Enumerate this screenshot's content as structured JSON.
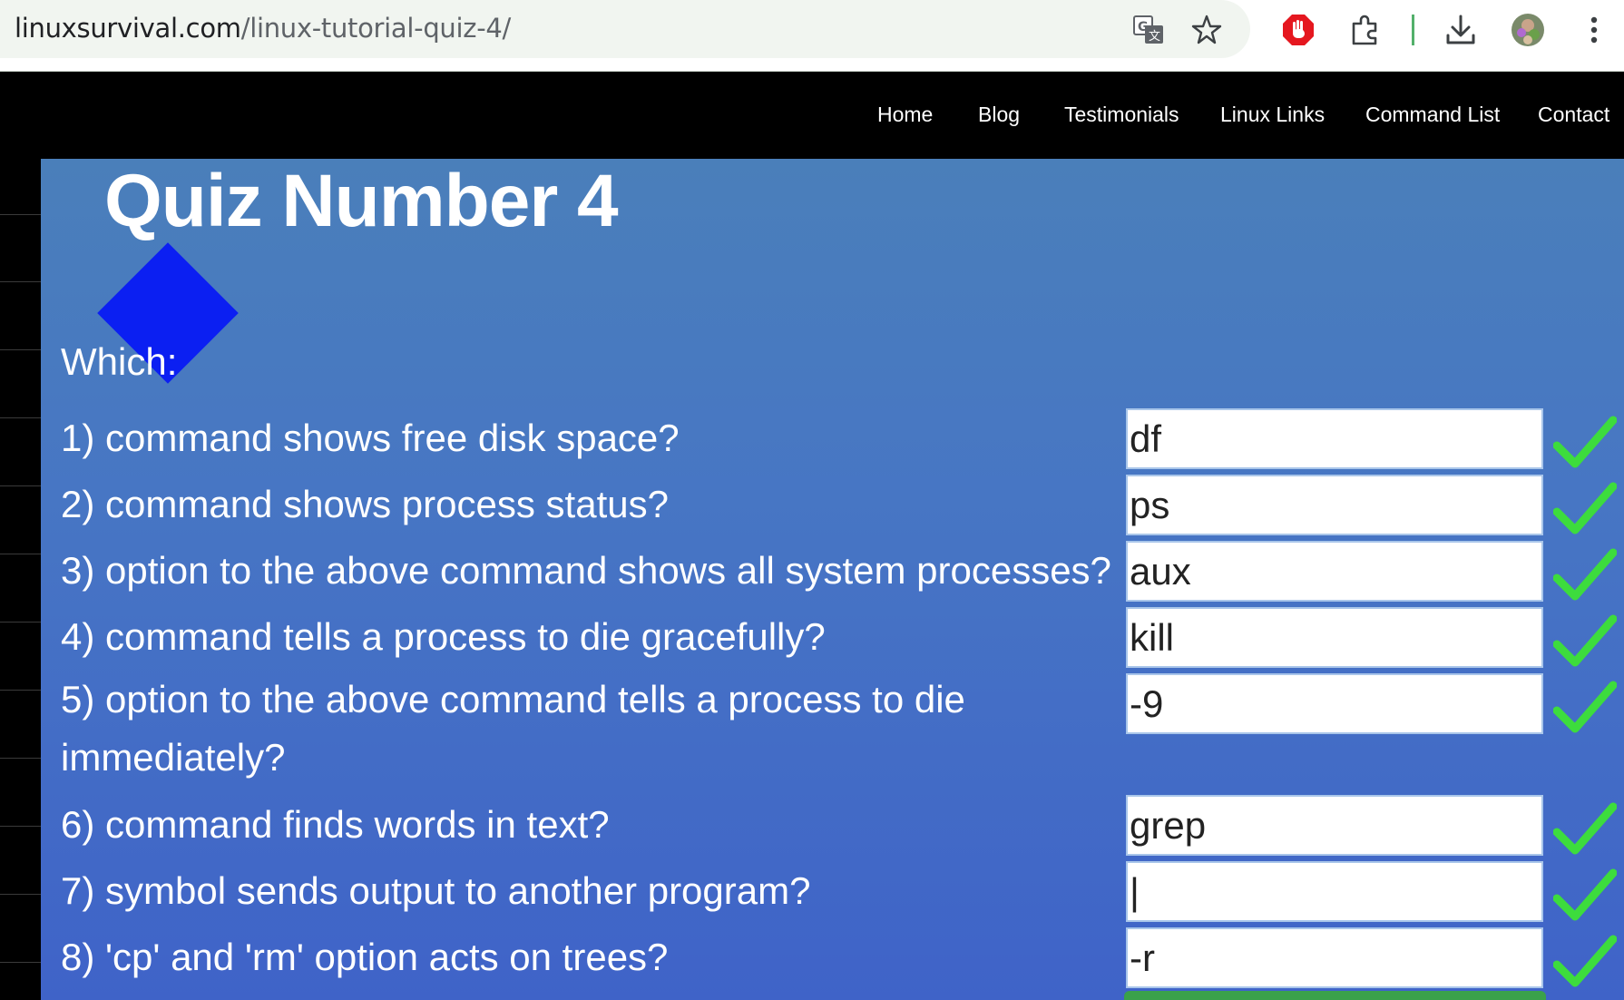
{
  "browser": {
    "url_domain": "linuxsurvival.com",
    "url_path": "/linux-tutorial-quiz-4/",
    "icons": [
      "translate-icon",
      "star-icon",
      "stop-hand-icon",
      "extensions-icon",
      "download-icon",
      "avatar",
      "more-icon"
    ]
  },
  "nav": {
    "items": [
      "Home",
      "Blog",
      "Testimonials",
      "Linux Links",
      "Command List",
      "Contact"
    ]
  },
  "page": {
    "logo_title": "Quiz Number 4",
    "intro": "Which:"
  },
  "questions": [
    {
      "text": "1) command shows free disk space?",
      "answer": "df",
      "correct": true
    },
    {
      "text": "2) command shows process status?",
      "answer": "ps",
      "correct": true
    },
    {
      "text": "3) option to the above command shows all system processes?",
      "answer": "aux",
      "correct": true
    },
    {
      "text": "4) command tells a process to die gracefully?",
      "answer": "kill",
      "correct": true
    },
    {
      "text": "5) option to the above command tells a process to die immediately?",
      "answer": "-9",
      "correct": true
    },
    {
      "text": "6) command finds words in text?",
      "answer": "grep",
      "correct": true
    },
    {
      "text": "7) symbol sends output to another program?",
      "answer": "|",
      "correct": true
    },
    {
      "text": "8) 'cp' and 'rm' option acts on trees?",
      "answer": "-r",
      "correct": true
    }
  ],
  "colors": {
    "check": "#3ddc3d",
    "logo_diamond": "#0b1ff2",
    "stop_badge": "#e5171f"
  }
}
